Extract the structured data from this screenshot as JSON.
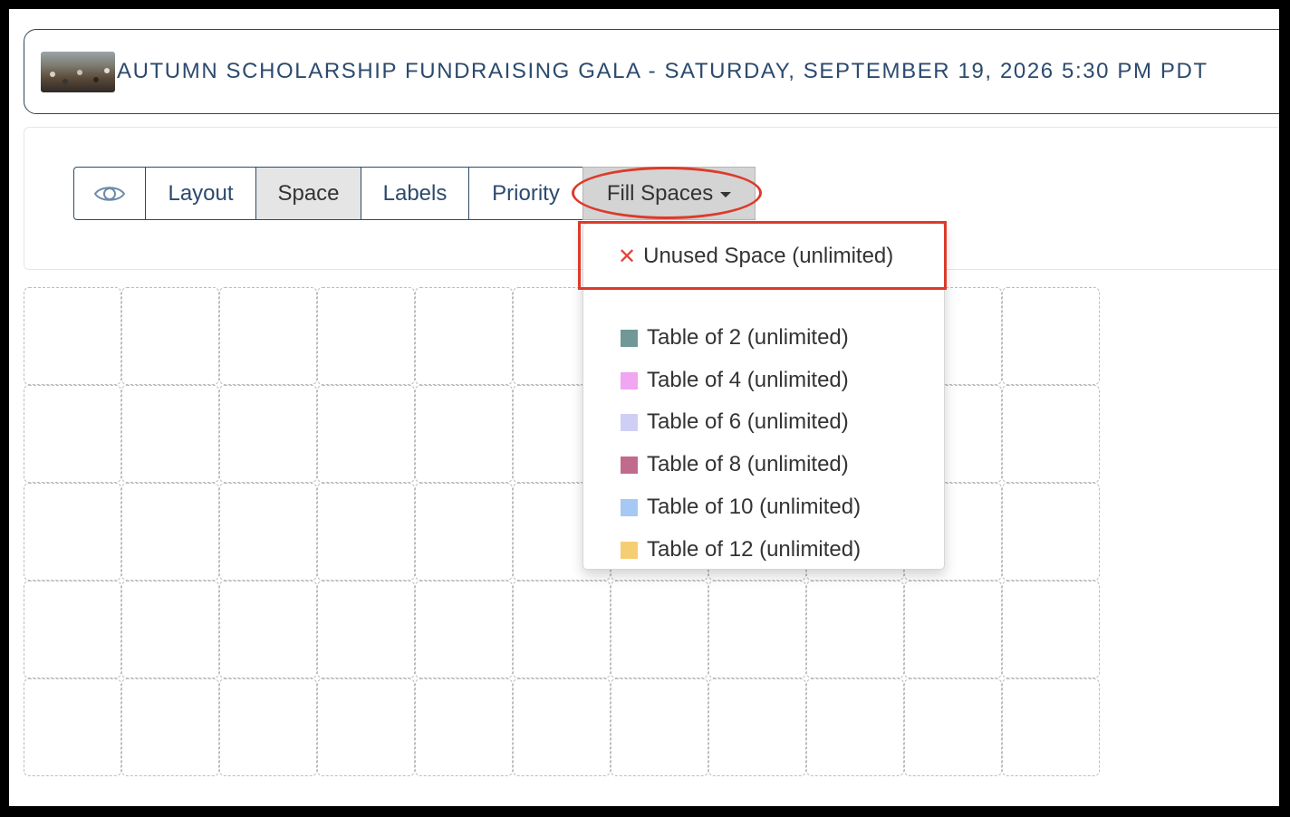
{
  "event": {
    "title": "AUTUMN SCHOLARSHIP FUNDRAISING GALA - SATURDAY, SEPTEMBER 19, 2026 5:30 PM PDT",
    "thumbnail_icon": "event-photo"
  },
  "toolbar": {
    "view_icon": "eye-icon",
    "buttons": [
      {
        "label": "Layout"
      },
      {
        "label": "Space"
      },
      {
        "label": "Labels"
      },
      {
        "label": "Priority"
      },
      {
        "label": "Fill Spaces"
      }
    ],
    "active": "Space"
  },
  "dropdown": {
    "unused": {
      "label": "Unused Space (unlimited)",
      "icon": "close-icon",
      "icon_color": "#e0453a"
    },
    "items": [
      {
        "label": "Table of 2 (unlimited)",
        "color": "#6f9896"
      },
      {
        "label": "Table of 4 (unlimited)",
        "color": "#f0a6f0"
      },
      {
        "label": "Table of 6 (unlimited)",
        "color": "#cfcff5"
      },
      {
        "label": "Table of 8 (unlimited)",
        "color": "#c06a8e"
      },
      {
        "label": "Table of 10 (unlimited)",
        "color": "#a6c8f5"
      },
      {
        "label": "Table of 12 (unlimited)",
        "color": "#f5ce74"
      }
    ]
  },
  "annotations": {
    "highlight_color": "#dc3b2a"
  },
  "grid": {
    "rows": 5,
    "cols": 11
  }
}
